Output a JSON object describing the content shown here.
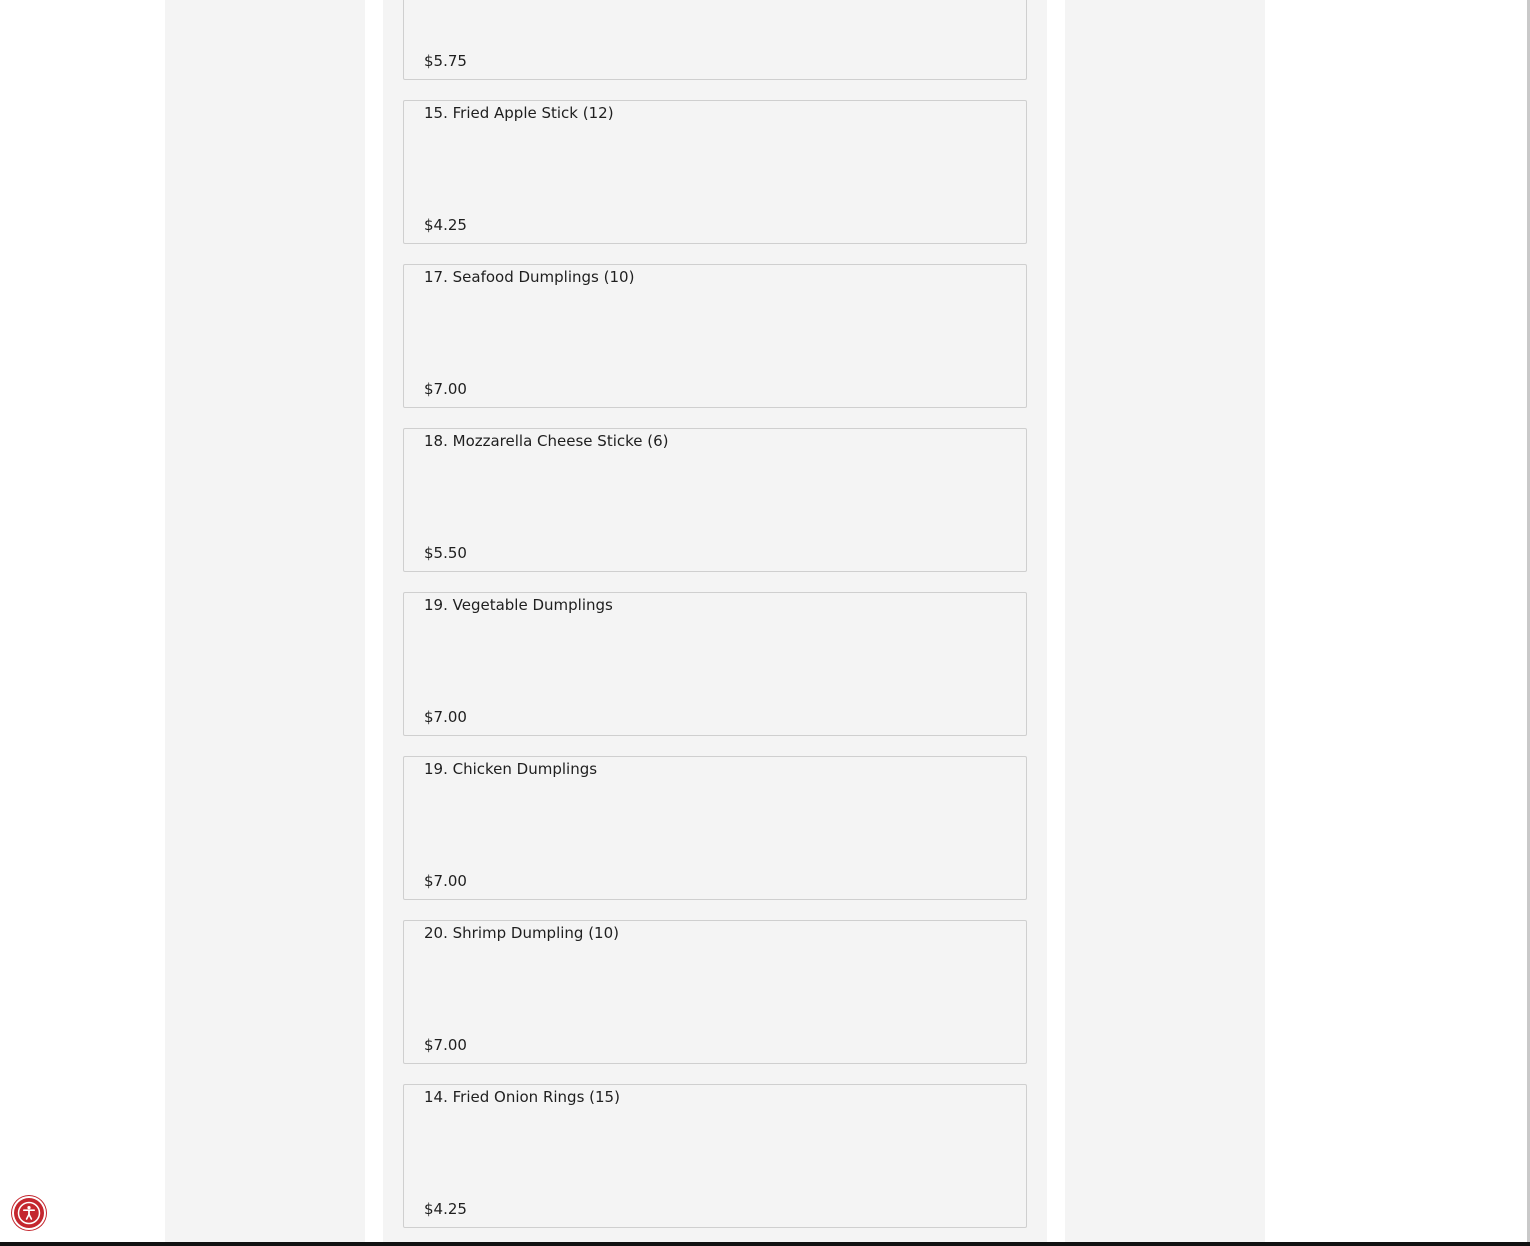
{
  "menu": {
    "items": [
      {
        "name": "",
        "price": "$5.75"
      },
      {
        "name": "15. Fried Apple Stick (12)",
        "price": "$4.25"
      },
      {
        "name": "17. Seafood Dumplings (10)",
        "price": "$7.00"
      },
      {
        "name": "18. Mozzarella Cheese Sticke (6)",
        "price": "$5.50"
      },
      {
        "name": "19. Vegetable Dumplings",
        "price": "$7.00"
      },
      {
        "name": "19. Chicken Dumplings",
        "price": "$7.00"
      },
      {
        "name": "20. Shrimp Dumpling (10)",
        "price": "$7.00"
      },
      {
        "name": "14. Fried Onion Rings (15)",
        "price": "$4.25"
      }
    ]
  },
  "accessibility": {
    "icon": "accessibility-icon",
    "color": "#c4262e"
  },
  "colors": {
    "panel_background": "#f4f4f4",
    "card_border": "#cfcfcf",
    "text": "#1f1f1f"
  }
}
